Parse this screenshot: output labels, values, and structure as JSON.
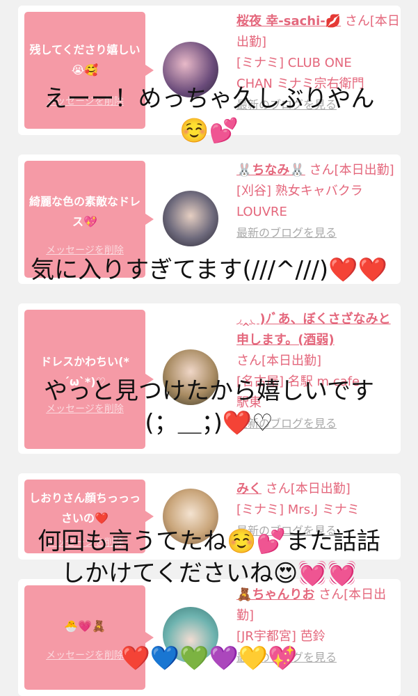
{
  "cards": [
    {
      "message": "残してくださり嬉しい😭🥰",
      "delete": "メッセージを削除",
      "name": "桜夜 幸-sachi-💋",
      "san": "さん[本日出勤]",
      "shop_line1": "[ミナミ] CLUB ONE",
      "shop_line2": "CHAN ミナミ宗右衛門",
      "blog": "最新のブログを見る"
    },
    {
      "message": "綺麗な色の素敵なドレス💖",
      "delete": "メッセージを削除",
      "name": "🐰ちなみ🐰",
      "san": "さん[本日出勤]",
      "shop_line1": "[刈谷] 熟女キャバクラ",
      "shop_line2": "LOUVRE",
      "blog": "最新のブログを見る"
    },
    {
      "message": "ドレスかわちい(*´ω`*)♡",
      "delete": "メッセージを削除",
      "name": "◞‸◟ )ﾉﾞあ、ぼくさざなみと申します。(酒弱)",
      "san": "さん[本日出勤]",
      "shop_line1": "[名古屋] 名駅 m cafe",
      "shop_line2": "駅東",
      "blog": "最新のブログを見る"
    },
    {
      "message": "しおりさん顔ちっっっさいの❤️",
      "delete": "メッセージを削除",
      "name": "みく",
      "san": "さん[本日出勤]",
      "shop_line1": "[ミナミ] Mrs.J ミナミ",
      "shop_line2": "",
      "blog": "最新のブログを見る"
    },
    {
      "message": "🐣💗🧸",
      "delete": "メッセージを削除",
      "name": "🧸ちゃんりお",
      "san": "さん[本日出勤]",
      "shop_line1": "[JR宇都宮] 芭鈴",
      "shop_line2": "",
      "blog": "最新のブログを見る"
    }
  ],
  "overlays": {
    "line1a": "えーー！めっちゃ久しぶりやん",
    "line1b": "☺️💕",
    "line2": "気に入りすぎてます(///^///)❤️❤️",
    "line3a": "やっと見つけたから嬉しいです",
    "line3b": "(；＿；)❤️♡",
    "line4a": "何回も言うてたね☺️💕また話話",
    "line4b": "しかけてくださいね😍💓💓",
    "line5": "❤️💙💚💜💛💖"
  }
}
